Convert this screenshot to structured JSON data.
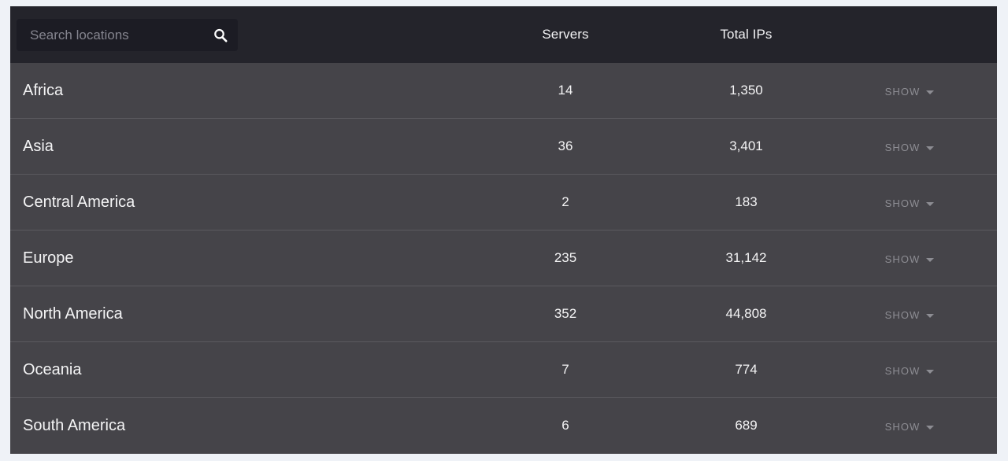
{
  "theme": {
    "page_background": "#eff2f7",
    "card_background": "#454449",
    "header_background": "#24242b",
    "search_background": "#1c1c24",
    "row_divider": "#5a595e",
    "text_primary": "#f4f4f5",
    "text_muted": "#8d8d93"
  },
  "search": {
    "placeholder": "Search locations",
    "value": "",
    "icon": "search-icon"
  },
  "table": {
    "columns": [
      {
        "key": "region",
        "label": ""
      },
      {
        "key": "servers",
        "label": "Servers"
      },
      {
        "key": "totalips",
        "label": "Total IPs"
      },
      {
        "key": "action",
        "label": ""
      }
    ],
    "action_label": "SHOW",
    "action_icon": "chevron-down-icon",
    "rows": [
      {
        "region": "Africa",
        "servers": "14",
        "total_ips": "1,350",
        "action": "SHOW"
      },
      {
        "region": "Asia",
        "servers": "36",
        "total_ips": "3,401",
        "action": "SHOW"
      },
      {
        "region": "Central America",
        "servers": "2",
        "total_ips": "183",
        "action": "SHOW"
      },
      {
        "region": "Europe",
        "servers": "235",
        "total_ips": "31,142",
        "action": "SHOW"
      },
      {
        "region": "North America",
        "servers": "352",
        "total_ips": "44,808",
        "action": "SHOW"
      },
      {
        "region": "Oceania",
        "servers": "7",
        "total_ips": "774",
        "action": "SHOW"
      },
      {
        "region": "South America",
        "servers": "6",
        "total_ips": "689",
        "action": "SHOW"
      }
    ]
  }
}
